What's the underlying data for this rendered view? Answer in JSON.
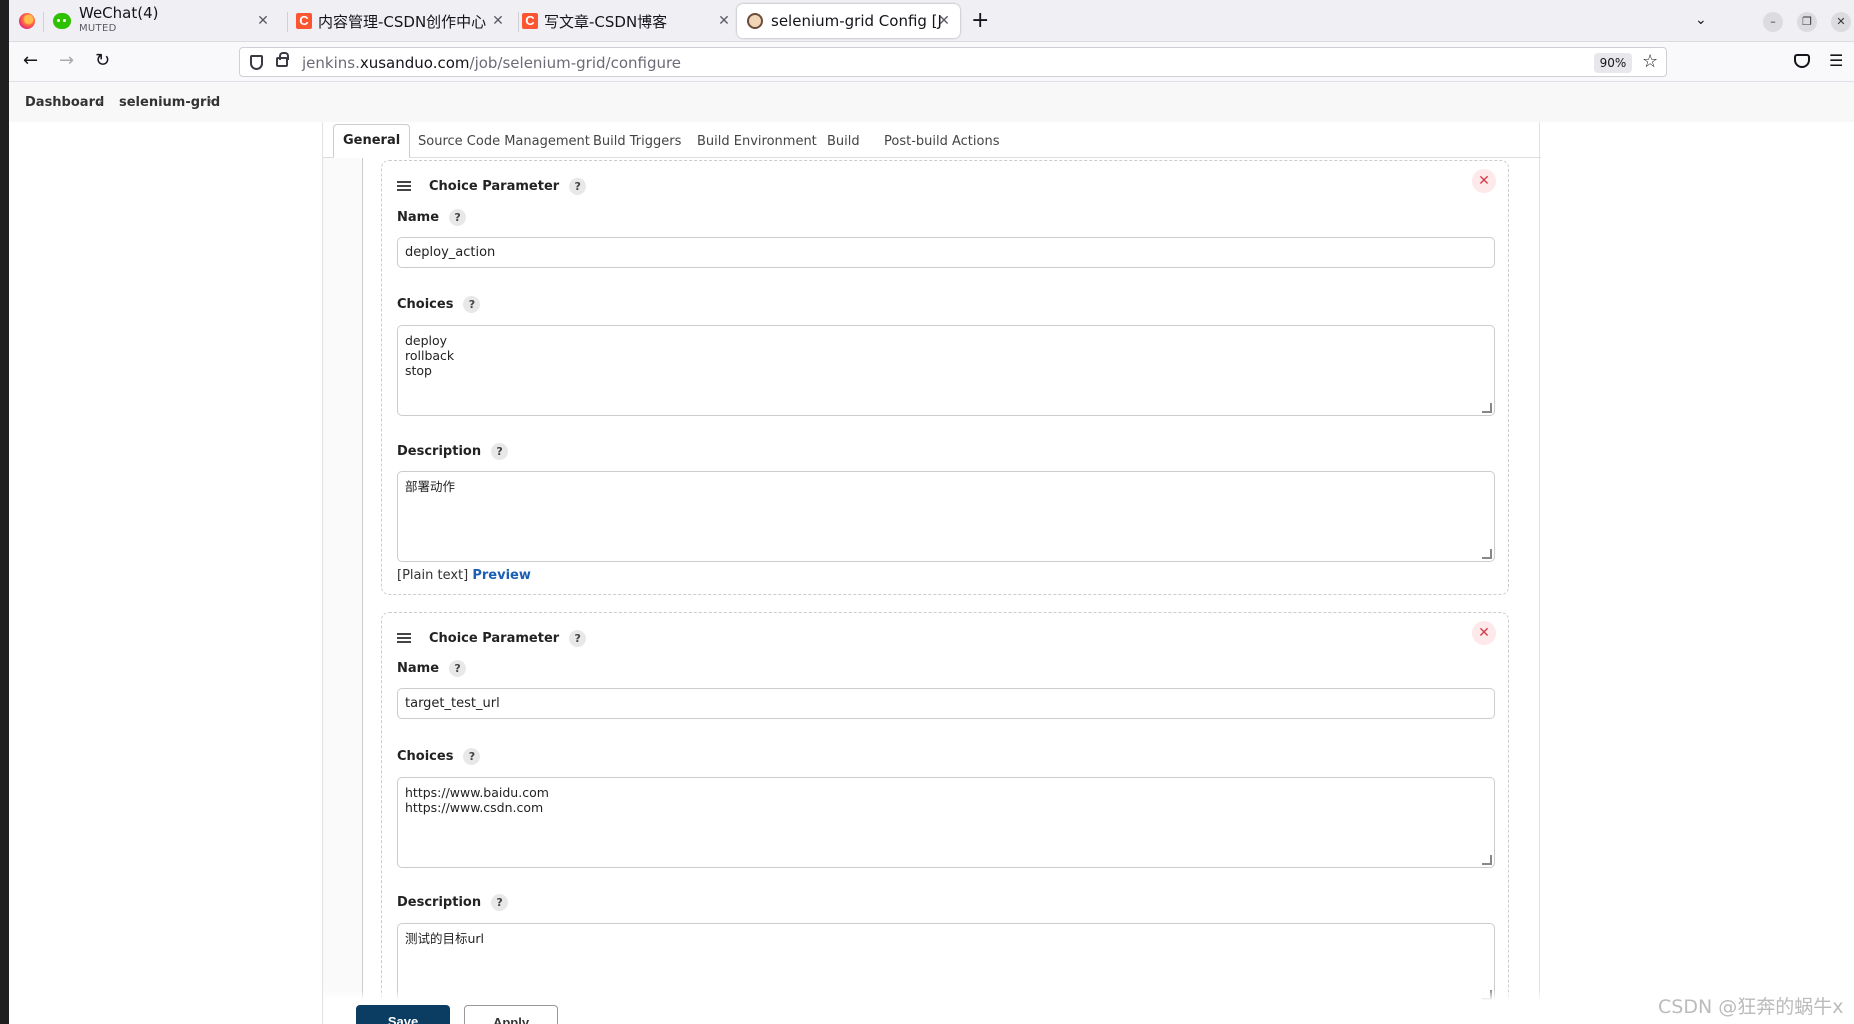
{
  "browser": {
    "tabs": [
      {
        "title": "WeChat(4)",
        "subtitle": "MUTED"
      },
      {
        "title": "内容管理-CSDN创作中心"
      },
      {
        "title": "写文章-CSDN博客"
      },
      {
        "title": "selenium-grid Config [Jen"
      }
    ],
    "url": {
      "prefix": "jenkins.",
      "host": "xusanduo.com",
      "path": "/job/selenium-grid/configure"
    },
    "zoom": "90%"
  },
  "breadcrumb": {
    "items": [
      "Dashboard",
      "selenium-grid"
    ]
  },
  "config_tabs": [
    "General",
    "Source Code Management",
    "Build Triggers",
    "Build Environment",
    "Build",
    "Post-build Actions"
  ],
  "params": [
    {
      "title": "Choice Parameter",
      "name_label": "Name",
      "name_value": "deploy_action",
      "choices_label": "Choices",
      "choices_value": "deploy\nrollback\nstop",
      "description_label": "Description",
      "description_value": "部署动作",
      "plain_text": "[Plain text]",
      "preview": "Preview"
    },
    {
      "title": "Choice Parameter",
      "name_label": "Name",
      "name_value": "target_test_url",
      "choices_label": "Choices",
      "choices_value": "https://www.baidu.com\nhttps://www.csdn.com",
      "description_label": "Description",
      "description_value": "测试的目标url"
    }
  ],
  "buttons": {
    "save": "Save",
    "apply": "Apply"
  },
  "help_glyph": "?",
  "watermark": "CSDN @狂奔的蜗牛x",
  "icons": [
    "firefox-icon",
    "wechat-icon",
    "csdn-icon",
    "jenkins-icon",
    "back-icon",
    "forward-icon",
    "reload-icon",
    "shield-icon",
    "lock-icon",
    "star-icon",
    "pocket-icon",
    "menu-icon",
    "drag-handle-icon",
    "close-icon",
    "help-icon"
  ]
}
